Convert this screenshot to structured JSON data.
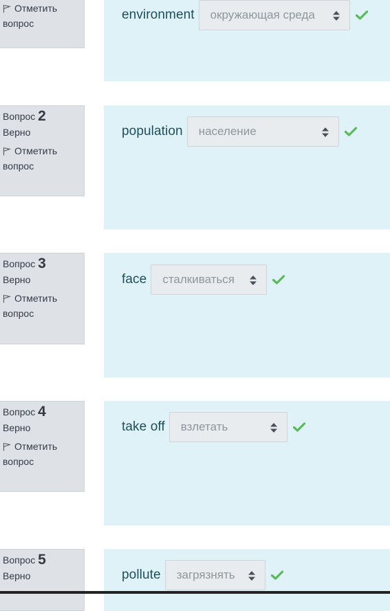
{
  "colors": {
    "info_bg": "#dee2e6",
    "content_bg": "#def2f8",
    "correct": "#5cb85c",
    "select_bg": "#e9ecef",
    "word_text": "#1f4e5a"
  },
  "questions": [
    {
      "state": "",
      "flag_label": "Отметить",
      "flag_label2": "вопрос",
      "word": "environment",
      "answer": "окружающая среда"
    },
    {
      "label": "Вопрос",
      "number": "2",
      "state": "Верно",
      "flag_label": "Отметить",
      "flag_label2": "вопрос",
      "word": "population",
      "answer": "население"
    },
    {
      "label": "Вопрос",
      "number": "3",
      "state": "Верно",
      "flag_label": "Отметить",
      "flag_label2": "вопрос",
      "word": "face",
      "answer": "сталкиваться"
    },
    {
      "label": "Вопрос",
      "number": "4",
      "state": "Верно",
      "flag_label": "Отметить",
      "flag_label2": "вопрос",
      "word": "take off",
      "answer": "взлетать"
    },
    {
      "label": "Вопрос",
      "number": "5",
      "state": "Верно",
      "word": "pollute",
      "answer": "загрязнять"
    }
  ]
}
